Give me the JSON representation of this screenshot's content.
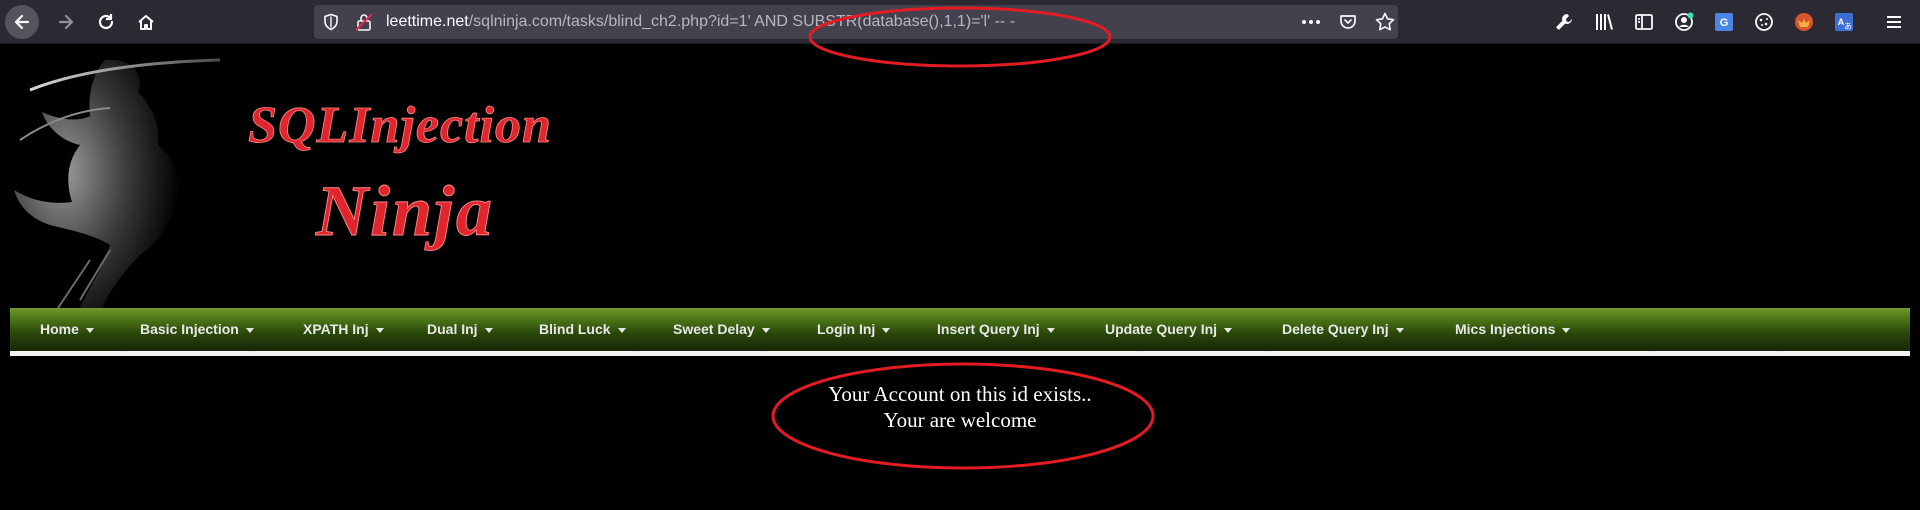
{
  "browser": {
    "url": {
      "host": "leettime.net",
      "path": "/sqlninja.com/tasks/blind_ch2.php?id=1' AND SUBSTR(database(),1,1)='l' -- -"
    },
    "toolbar_icons": {
      "back": "back-arrow-icon",
      "forward": "forward-arrow-icon",
      "reload": "reload-icon",
      "home": "home-icon",
      "more": "more-dots-icon",
      "pocket": "pocket-icon",
      "bookmark": "star-icon"
    },
    "extensions": [
      "wrench-icon",
      "library-icon",
      "sidebar-icon",
      "account-icon",
      "translate-icon",
      "cookie-icon",
      "fox-addon-icon",
      "translate-addon-icon",
      "hamburger-menu-icon"
    ]
  },
  "banner": {
    "logo_line1": "SQLInjection",
    "logo_line2": "Ninja"
  },
  "menu": [
    {
      "label": "Home"
    },
    {
      "label": "Basic Injection"
    },
    {
      "label": "XPATH Inj"
    },
    {
      "label": "Dual Inj"
    },
    {
      "label": "Blind Luck"
    },
    {
      "label": "Sweet Delay"
    },
    {
      "label": "Login Inj"
    },
    {
      "label": "Insert Query Inj"
    },
    {
      "label": "Update Query Inj"
    },
    {
      "label": "Delete Query Inj"
    },
    {
      "label": "Mics Injections"
    }
  ],
  "message": {
    "line1": "Your Account on this id exists..",
    "line2": "Your are welcome"
  },
  "colors": {
    "page_bg": "#000000",
    "menu_green": "#4f7a18",
    "logo_red": "#e0262c",
    "annotation_red": "#e31b23"
  }
}
